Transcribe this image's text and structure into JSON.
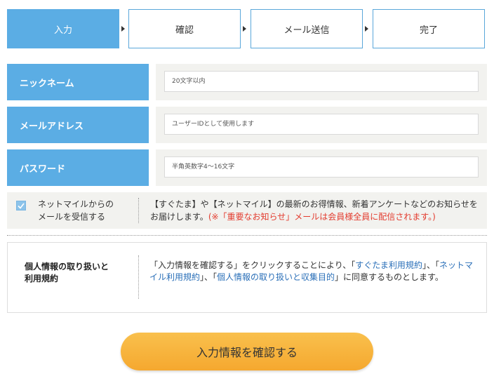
{
  "steps": {
    "items": [
      {
        "label": "入力"
      },
      {
        "label": "確認"
      },
      {
        "label": "メール送信"
      },
      {
        "label": "完了"
      }
    ]
  },
  "form": {
    "nickname": {
      "label": "ニックネーム",
      "placeholder": "20文字以内"
    },
    "email": {
      "label": "メールアドレス",
      "placeholder": "ユーザーIDとして使用します"
    },
    "password": {
      "label": "パスワード",
      "placeholder": "半角英数字4〜16文字"
    }
  },
  "optin": {
    "checked": true,
    "label_line1": "ネットマイルからの",
    "label_line2": "メールを受信する",
    "desc_main": "【すぐたま】や【ネットマイル】の最新のお得情報、新着アンケートなどのお知らせをお届けします。",
    "desc_note": "(※「重要なお知らせ」メールは会員様全員に配信されます。)"
  },
  "privacy": {
    "title_line1": "個人情報の取り扱いと",
    "title_line2": "利用規約",
    "text_1": "「入力情報を確認する」をクリックすることにより、「",
    "link_1": "すぐたま利用規約",
    "text_2": "」、「",
    "link_2": "ネットマイル利用規約",
    "text_3": "」、「",
    "link_3": "個人情報の取り扱いと収集目的",
    "text_4": "」に同意するものとします。"
  },
  "submit": {
    "label": "入力情報を確認する"
  },
  "colors": {
    "accent": "#5bade4",
    "field_bg": "#f2f2ef",
    "button": "#f5a82f",
    "link": "#2a6fb8",
    "warning": "#e33b2e"
  }
}
